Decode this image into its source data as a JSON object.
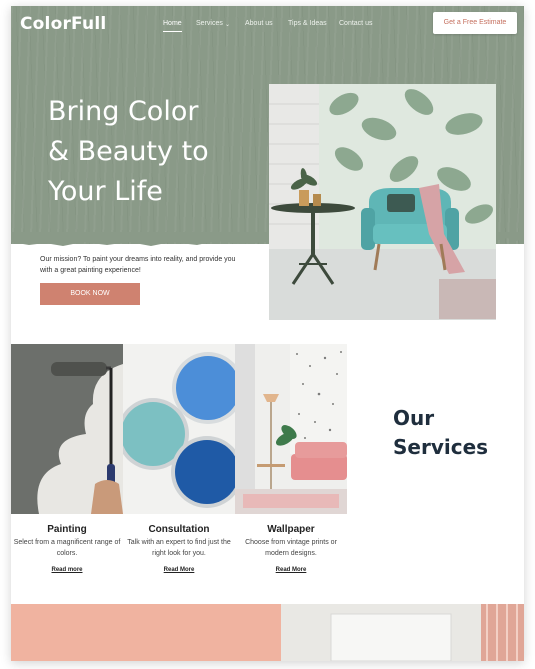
{
  "brand": {
    "logo": "ColorFull",
    "accent": "#cf8270",
    "hero_bg": "#8a9a88",
    "heading_color": "#1f2e3d"
  },
  "nav": {
    "items": [
      "Home",
      "Services",
      "About us",
      "Tips & Ideas",
      "Contact us"
    ],
    "active": "Home",
    "services_chevron": "chevron-down-icon",
    "cta": "Get a Free Estimate"
  },
  "hero": {
    "headline": [
      "Bring Color",
      "& Beauty to",
      "Your Life"
    ],
    "mission": "Our mission? To paint your dreams into reality, and provide you with a great painting experience!",
    "button": "BOOK NOW"
  },
  "services": {
    "heading": [
      "Our",
      "Services"
    ],
    "cards": [
      {
        "title": "Painting",
        "desc": "Select from a magnificent range of colors.",
        "link": "Read more"
      },
      {
        "title": "Consultation",
        "desc": "Talk with an expert to find just the right look for you.",
        "link": "Read More"
      },
      {
        "title": "Wallpaper",
        "desc": "Choose from vintage prints or modern designs.",
        "link": "Read More"
      }
    ]
  }
}
